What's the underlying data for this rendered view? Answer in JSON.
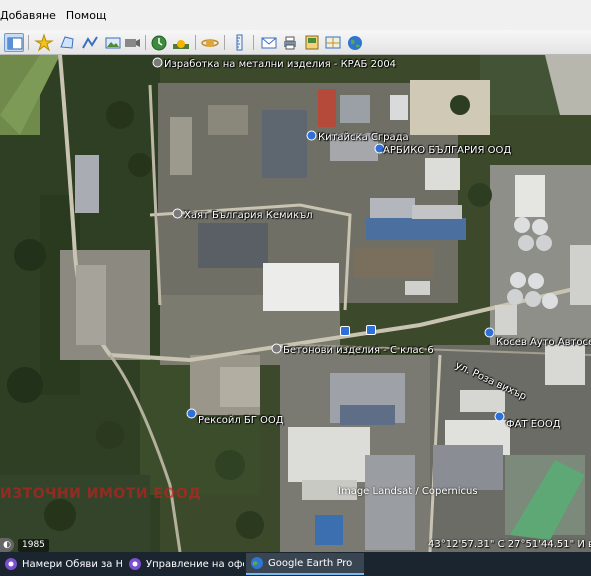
{
  "menu": {
    "items": [
      "Добавяне",
      "Помощ"
    ]
  },
  "toolbar": {
    "buttons": [
      "sidebar-toggle-icon",
      "placemark-icon",
      "polygon-icon",
      "path-icon",
      "image-overlay-icon",
      "record-tour-icon",
      "historical-imagery-icon",
      "sunlight-icon",
      "planets-icon",
      "ruler-icon",
      "email-icon",
      "print-icon",
      "save-image-icon",
      "view-in-maps-icon",
      "earth-icon"
    ]
  },
  "map": {
    "labels": {
      "krab": "Изработка на метални изделия - КРАБ 2004",
      "kitaika": "Китайска Сграда",
      "arbiko": "АРБИКО БЪЛГАРИЯ ООД",
      "haiat": "Хаят България Кемикъл",
      "betonovi": "Бетонови изделия - С клас 6",
      "kosev": "Косев Ауто Автосервиз",
      "street": "ул. Роза вихър",
      "reksoil": "Рексойл БГ ООД",
      "fat": "ФАТ ЕООД"
    },
    "watermark": "ИЗТОЧНИ ИМОТИ ЕООД",
    "imagery_credit": "Image Landsat / Copernicus",
    "year": "1985",
    "coordinates": "43°12'57.31\" С  27°51'44.51\" И  височ"
  },
  "taskbar": {
    "tasks": [
      {
        "label": "Намери Обяви за Не...",
        "icon": "browser-icon",
        "active": false
      },
      {
        "label": "Управление на офер...",
        "icon": "browser-icon",
        "active": false
      },
      {
        "label": "Google Earth Pro",
        "icon": "google-earth-icon",
        "active": true
      }
    ]
  },
  "colors": {
    "taskbar": "#1b2530",
    "pin_blue": "#2f6fd8",
    "watermark": "#c81e1e"
  }
}
